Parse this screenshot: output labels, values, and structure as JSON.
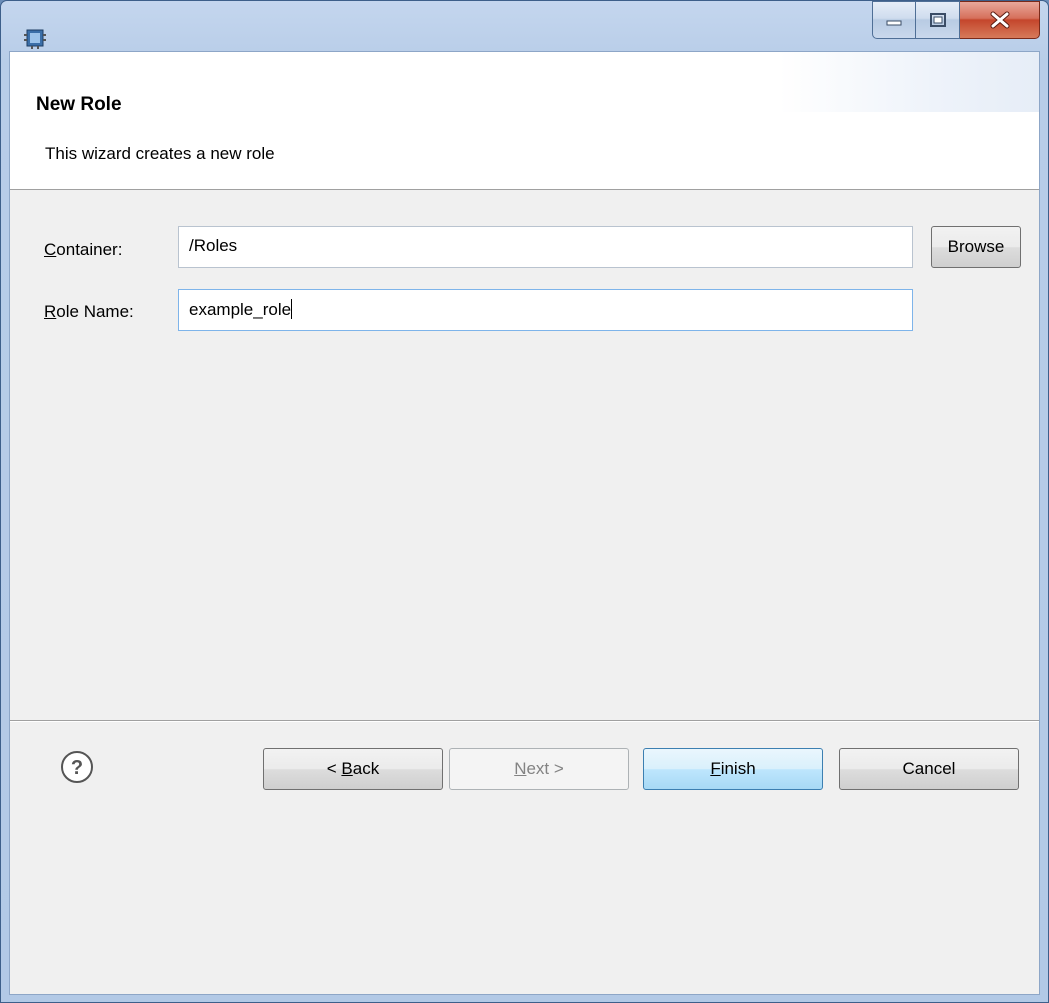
{
  "header": {
    "title": "New Role",
    "description": "This wizard creates a new role"
  },
  "form": {
    "container": {
      "label_mnemonic": "C",
      "label_rest": "ontainer:",
      "value": "/Roles"
    },
    "role_name": {
      "label_mnemonic": "R",
      "label_rest": "ole Name:",
      "value": "example_role"
    },
    "browse_label": "Browse"
  },
  "footer": {
    "back": {
      "prefix": "< ",
      "mnemonic": "B",
      "rest": "ack"
    },
    "next": {
      "mnemonic": "N",
      "rest": "ext >"
    },
    "finish": {
      "mnemonic": "F",
      "rest": "inish"
    },
    "cancel": "Cancel",
    "help_glyph": "?"
  },
  "icons": {
    "app": "application-icon",
    "minimize": "minimize-icon",
    "maximize": "maximize-icon",
    "close": "close-icon",
    "help": "help-icon"
  },
  "colors": {
    "frame": "#b8cde8",
    "close_button": "#c4462c",
    "default_button": "#3c7fb1",
    "focus_border": "#7eb4ea"
  }
}
